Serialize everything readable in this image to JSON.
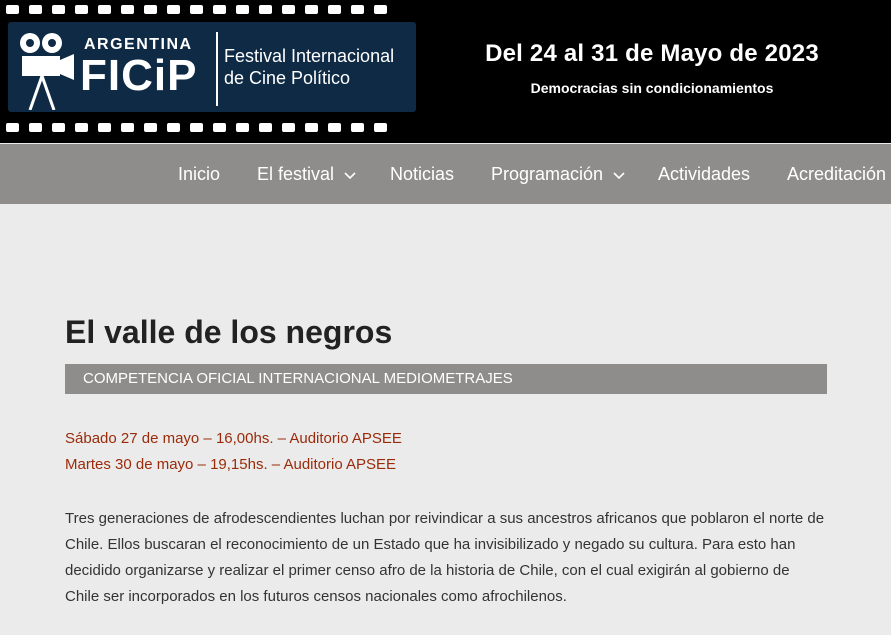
{
  "header": {
    "logo": {
      "country": "ARGENTINA",
      "name": "FICiP",
      "tagline_line1": "Festival Internacional",
      "tagline_line2": "de Cine Político"
    },
    "dates": "Del 24 al 31 de Mayo de 2023",
    "tagline": "Democracias sin condicionamientos"
  },
  "nav": {
    "items": [
      {
        "label": "Inicio",
        "has_submenu": false
      },
      {
        "label": "El festival",
        "has_submenu": true
      },
      {
        "label": "Noticias",
        "has_submenu": false
      },
      {
        "label": "Programación",
        "has_submenu": true
      },
      {
        "label": "Actividades",
        "has_submenu": false
      },
      {
        "label": "Acreditación",
        "has_submenu": false
      }
    ]
  },
  "content": {
    "title": "El valle de los negros",
    "category": "COMPETENCIA OFICIAL INTERNACIONAL MEDIOMETRAJES",
    "screenings": [
      "Sábado 27 de mayo – 16,00hs. – Auditorio APSEE",
      "Martes 30 de mayo – 19,15hs. – Auditorio APSEE"
    ],
    "description": "Tres generaciones de afrodescendientes luchan por reivindicar a sus ancestros africanos que poblaron el norte de Chile. Ellos buscaran el reconocimiento de un Estado que ha invisibilizado y negado su cultura. Para esto han decidido organizarse y realizar el primer censo afro de la historia de Chile, con el cual exigirán al gobierno de Chile ser incorporados en los futuros censos nacionales como afrochilenos."
  },
  "colors": {
    "header_bg": "#000000",
    "nav_bg": "#8f8c8c",
    "page_bg": "#ebebeb",
    "screening_text": "#9a2b0a",
    "logo_panel": "#0e2a45"
  },
  "icons": {
    "logo": "film-camera-icon",
    "submenu": "chevron-down-icon"
  }
}
